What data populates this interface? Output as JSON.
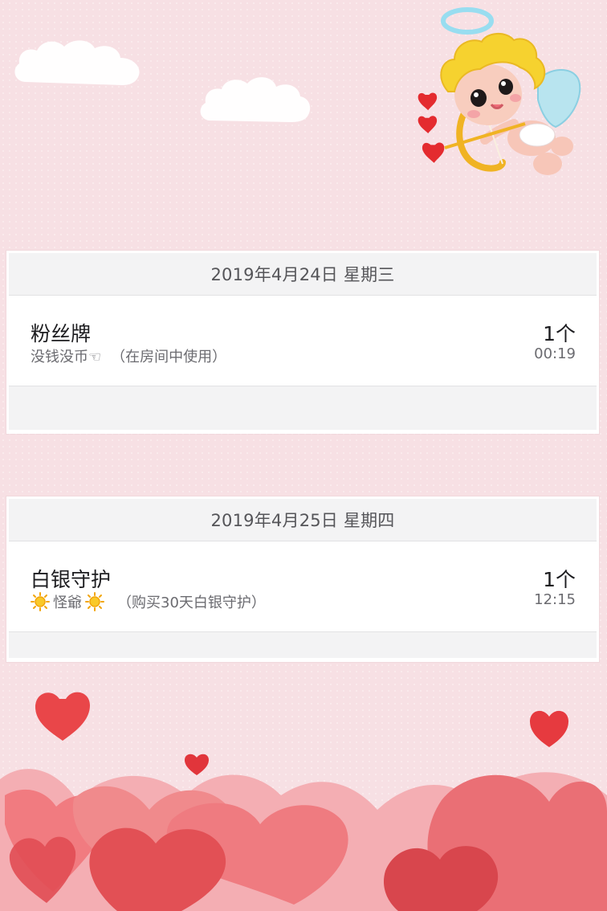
{
  "records": [
    {
      "date": "2019年4月24日 星期三",
      "title": "粉丝牌",
      "user_name": "没钱没币☜",
      "note": "（在房间中使用）",
      "count": "1个",
      "time": "00:19",
      "user_icons": []
    },
    {
      "date": "2019年4月25日 星期四",
      "title": "白银守护",
      "user_name": "怪爺",
      "note": "（购买30天白银守护）",
      "count": "1个",
      "time": "12:15",
      "user_icons": [
        "sun-icon",
        "sun-icon"
      ]
    }
  ],
  "theme": {
    "background": "#f7e0e4",
    "heart_light": "#f08a8c",
    "heart_dark": "#e85b5d",
    "cloud": "#ffffff",
    "cupid_hair": "#f6d22f",
    "cupid_wing": "#b8e4ef"
  },
  "decorations": [
    "cloud-icon",
    "cupid-icon",
    "heart-icon",
    "sun-icon"
  ]
}
